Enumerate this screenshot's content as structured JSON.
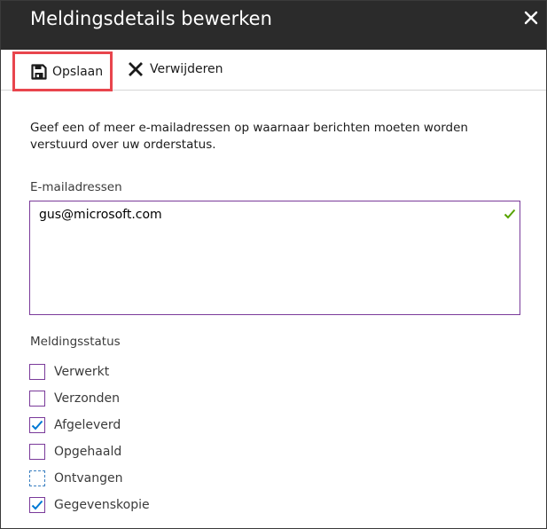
{
  "header": {
    "title": "Meldingsdetails bewerken",
    "close_icon": "close-icon"
  },
  "toolbar": {
    "save_label": "Opslaan",
    "save_icon": "save-icon",
    "delete_label": "Verwijderen",
    "delete_icon": "x-icon"
  },
  "form": {
    "description": "Geef een of meer e-mailadressen op waarnaar berichten moeten worden verstuurd over uw orderstatus.",
    "email_label": "E-mailadressen",
    "email_value": "gus@microsoft.com",
    "status_label": "Meldingsstatus",
    "statuses": [
      {
        "label": "Verwerkt",
        "checked": false
      },
      {
        "label": "Verzonden",
        "checked": false
      },
      {
        "label": "Afgeleverd",
        "checked": true
      },
      {
        "label": "Opgehaald",
        "checked": false
      },
      {
        "label": "Ontvangen",
        "checked": false
      },
      {
        "label": "Gegevenskopie",
        "checked": true
      }
    ]
  },
  "colors": {
    "titlebar_bg": "#2b2b2b",
    "highlight_border": "#e8454d",
    "input_border": "#7a3a9a",
    "check_color": "#0078d4",
    "valid_check": "#57a300"
  }
}
